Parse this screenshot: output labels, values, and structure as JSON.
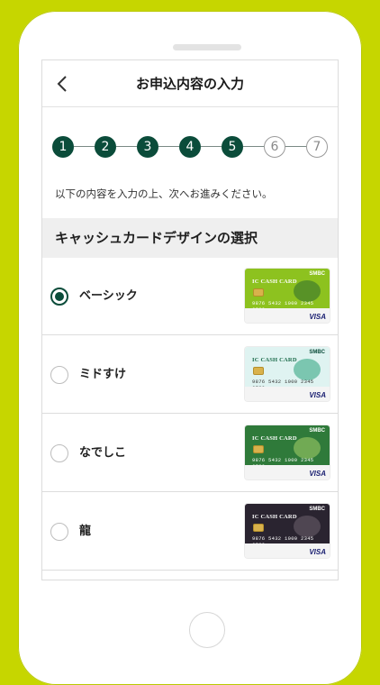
{
  "header": {
    "title": "お申込内容の入力"
  },
  "stepper": {
    "steps": [
      "1",
      "2",
      "3",
      "4",
      "5",
      "6",
      "7"
    ],
    "current": 5
  },
  "intro_text": "以下の内容を入力の上、次へお進みください。",
  "section": {
    "title": "キャッシュカードデザインの選択"
  },
  "options": [
    {
      "label": "ベーシック",
      "checked": true,
      "card": {
        "band_color": "#8dc21f",
        "accent": "#2e6b2e",
        "label": "IC CASH CARD",
        "brand": "SMBC",
        "number": "9876 5432 1000 2345 6789",
        "network": "VISA"
      }
    },
    {
      "label": "ミドすけ",
      "checked": false,
      "card": {
        "band_color": "#dff3f1",
        "accent": "#28a07a",
        "label": "IC CASH CARD",
        "brand": "SMBC",
        "number": "9876 5432 1000 2345 6789",
        "network": "VISA"
      }
    },
    {
      "label": "なでしこ",
      "checked": false,
      "card": {
        "band_color": "#2f7a3a",
        "accent": "#a8d16a",
        "label": "IC CASH CARD",
        "brand": "SMBC",
        "number": "9876 5432 1000 2345 6789",
        "network": "VISA"
      }
    },
    {
      "label": "龍",
      "checked": false,
      "card": {
        "band_color": "#2a2430",
        "accent": "#6e6270",
        "label": "IC CASH CARD",
        "brand": "SMBC",
        "number": "9876 5432 1000 2345 6789",
        "network": "VISA"
      }
    }
  ],
  "colors": {
    "brand_green": "#0b4c3a",
    "background": "#c6d600"
  }
}
